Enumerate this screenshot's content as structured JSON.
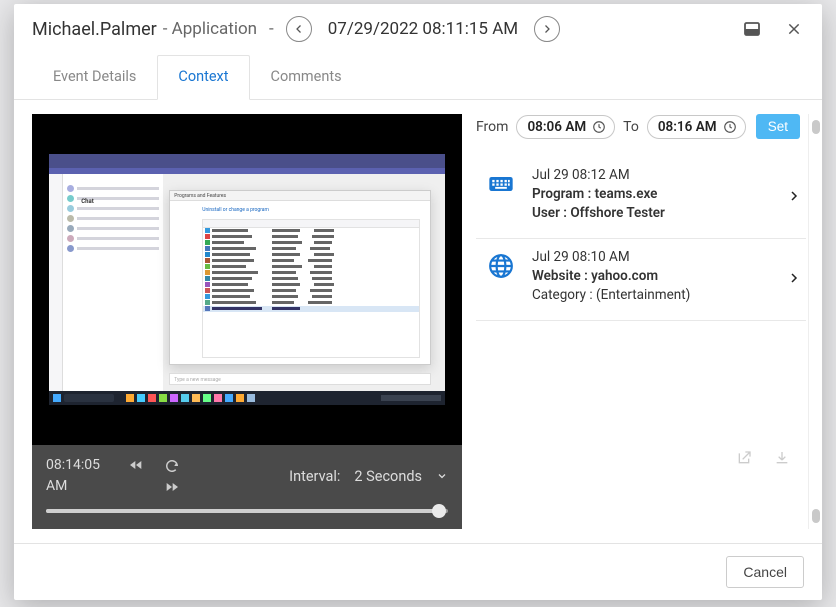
{
  "header": {
    "user": "Michael.Palmer",
    "title_suffix": " - Application",
    "dash": "-",
    "timestamp": "07/29/2022 08:11:15 AM"
  },
  "tabs": {
    "event_details": "Event Details",
    "context": "Context",
    "comments": "Comments",
    "active": "context"
  },
  "player": {
    "current_time_1": "08:14:05",
    "current_time_2": "AM",
    "interval_label": "Interval:",
    "interval_value": "2 Seconds"
  },
  "filter": {
    "from_label": "From",
    "from_value": "08:06 AM",
    "to_label": "To",
    "to_value": "08:16 AM",
    "set_label": "Set"
  },
  "events": [
    {
      "kind": "program",
      "time": "Jul 29 08:12 AM",
      "line1_key": "Program :",
      "line1_val": " teams.exe",
      "line2_key": "User :",
      "line2_val": " Offshore Tester"
    },
    {
      "kind": "website",
      "time": "Jul 29 08:10 AM",
      "line1_key": "Website :",
      "line1_val": " yahoo.com",
      "line2_key": "Category :",
      "line2_val": " (Entertainment)"
    }
  ],
  "footer": {
    "cancel": "Cancel"
  }
}
